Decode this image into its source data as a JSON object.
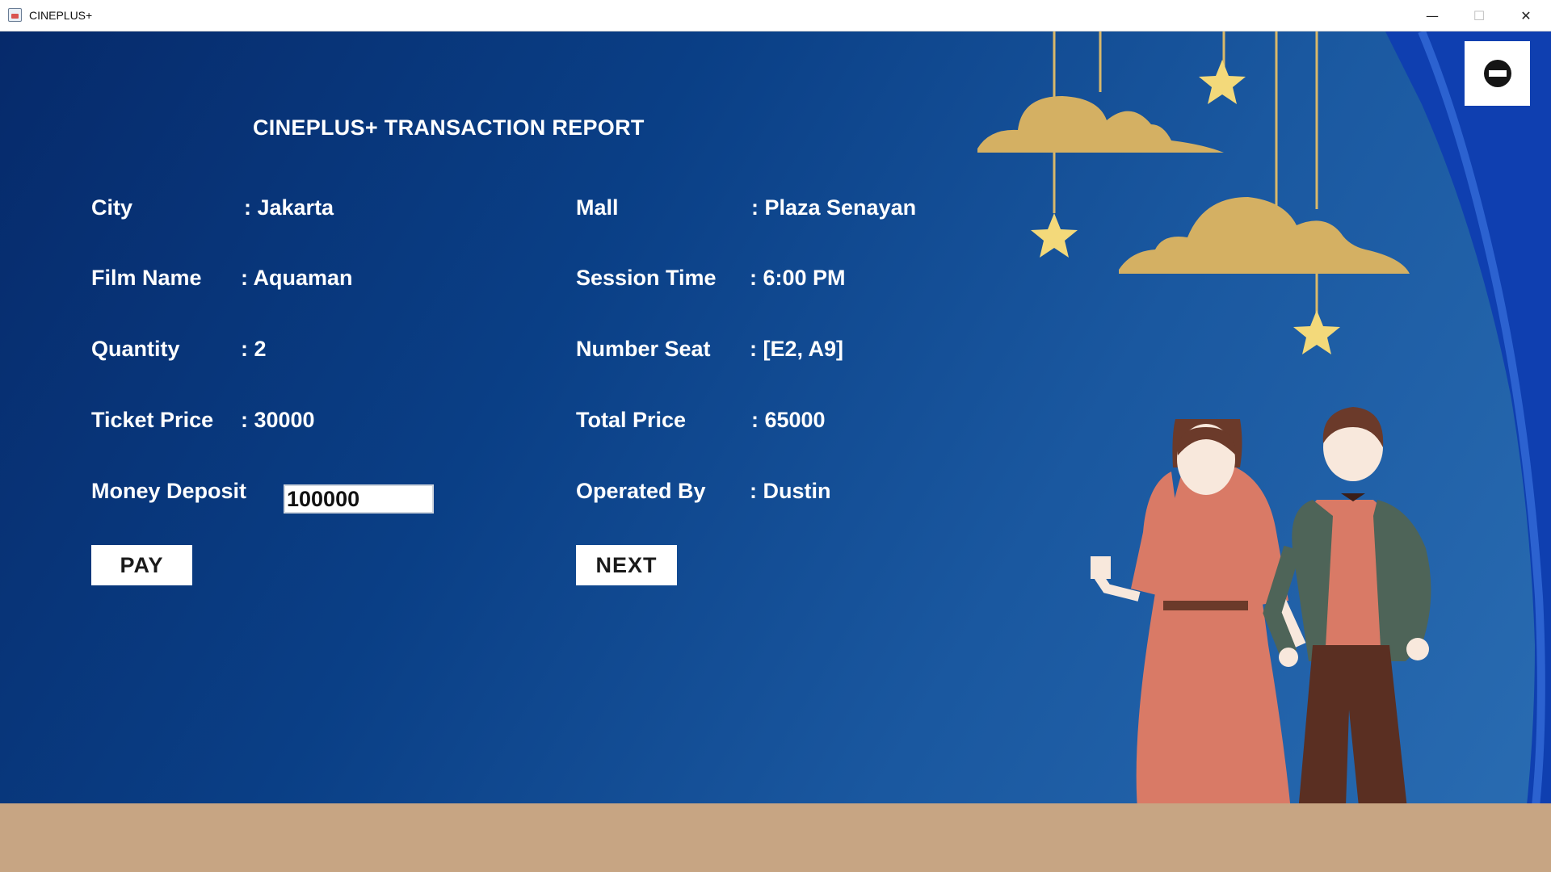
{
  "window": {
    "title": "CINEPLUS+",
    "minimize_glyph": "—",
    "maximize_glyph": "☐",
    "close_glyph": "✕"
  },
  "report": {
    "title": "CINEPLUS+ TRANSACTION REPORT",
    "fields": {
      "city": {
        "label": "City",
        "value": ": Jakarta"
      },
      "mall": {
        "label": "Mall",
        "value": ": Plaza Senayan"
      },
      "film_name": {
        "label": "Film Name",
        "value": ": Aquaman"
      },
      "session_time": {
        "label": "Session Time",
        "value": ": 6:00 PM"
      },
      "quantity": {
        "label": "Quantity",
        "value": ": 2"
      },
      "number_seat": {
        "label": "Number Seat",
        "value": ": [E2, A9]"
      },
      "ticket_price": {
        "label": "Ticket Price",
        "value": ": 30000"
      },
      "total_price": {
        "label": "Total Price",
        "value": ": 65000"
      },
      "money_deposit": {
        "label": "Money Deposit",
        "value": "100000"
      },
      "operated_by": {
        "label": "Operated By",
        "value": ": Dustin"
      }
    }
  },
  "buttons": {
    "pay": "PAY",
    "next": "NEXT",
    "exit_icon": "no-entry-icon"
  },
  "colors": {
    "background_dark": "#062a6b",
    "background_light": "#2a6db3",
    "floor": "#c7a583",
    "curtain": "#0f3fb0",
    "text": "#ffffff"
  }
}
